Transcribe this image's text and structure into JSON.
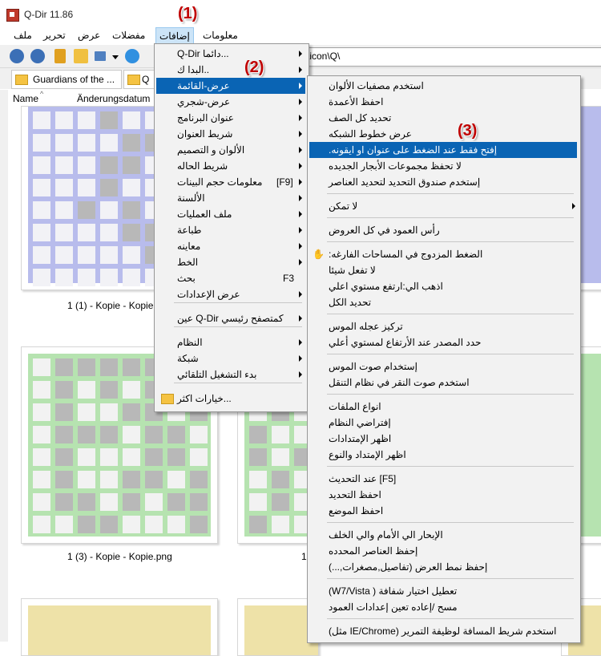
{
  "window": {
    "title": "Q-Dir 11.86"
  },
  "menubar": {
    "items": [
      "ملف",
      "تحرير",
      "عرض",
      "مفضلات",
      "إضافات",
      "معلومات"
    ]
  },
  "address": {
    "value": "\\icon\\Q\\"
  },
  "tabs": [
    {
      "label": "Guardians of the ..."
    },
    {
      "label": "Q"
    }
  ],
  "columns": {
    "name": "Name",
    "date": "Änderungsdatum"
  },
  "files": [
    {
      "caption": "1 (1) - Kopie - Kopie."
    },
    {
      "caption": "1 (3) - Kopie - Kopie.png"
    },
    {
      "caption": "1"
    }
  ],
  "callouts": [
    "(1)",
    "(2)",
    "(3)"
  ],
  "menu1": {
    "items": [
      {
        "label": "Q-Dir دائما...",
        "arrow": true
      },
      {
        "label": "البدا ك..",
        "arrow": true
      },
      {
        "label": "عرض-القائمة",
        "arrow": true,
        "highlight": true
      },
      {
        "label": "عرض-شجري",
        "arrow": true
      },
      {
        "label": "عنوان البرنامج",
        "arrow": true
      },
      {
        "label": "شريط العنوان",
        "arrow": true
      },
      {
        "label": "الألوان و التصميم",
        "arrow": true
      },
      {
        "label": "شريط الحاله",
        "arrow": true
      },
      {
        "label": "معلومات حجم البينات",
        "arrow": true,
        "shortcut": "[F9]"
      },
      {
        "label": "الألسنة",
        "arrow": true
      },
      {
        "label": "ملف العمليات",
        "arrow": true
      },
      {
        "label": "طباعة",
        "arrow": true
      },
      {
        "label": "معاينه",
        "arrow": true
      },
      {
        "label": "الخط",
        "arrow": true
      },
      {
        "label": "بحث",
        "arrow": false,
        "shortcut": "F3"
      },
      {
        "label": "عرض الإعدادات",
        "arrow": true
      },
      {
        "label": "عين Q-Dir كمتصفح رئيسي",
        "arrow": true
      },
      {
        "label": "النظام",
        "arrow": true
      },
      {
        "label": "شبكة",
        "arrow": true
      },
      {
        "label": "بدء التشغيل التلقائي",
        "arrow": true
      },
      {
        "label": "خيارات اكثر...",
        "arrow": false
      }
    ]
  },
  "menu2": {
    "items": [
      {
        "label": "استخدم مصفيات الألوان"
      },
      {
        "label": "احفظ الأعمدة"
      },
      {
        "label": "تحديد كل الصف"
      },
      {
        "label": "عرض خطوط الشبكه"
      },
      {
        "label": "إفتح فقط عند الضغط على عنوان او ايقونه.",
        "highlight": true
      },
      {
        "label": "لا تحفظ مجموعات الأبجار الجديده"
      },
      {
        "label": "إستخدم صندوق التحديد لتحديد العناصر"
      },
      {
        "label": "لا تمكن",
        "arrow": true
      },
      {
        "label": "رأس العمود في كل العروض"
      },
      {
        "label": "الضغط المزدوج في المساحات الفارغه:"
      },
      {
        "label": "لا تفعل شيئا"
      },
      {
        "label": "اذهب الي:ارتفع مستوي اعلي"
      },
      {
        "label": "تحديد الكل"
      },
      {
        "label": "تركيز عجله الموس"
      },
      {
        "label": "حدد المصدر عند الأرتفاع لمستوي أعلي"
      },
      {
        "label": "إستخدام صوت الموس"
      },
      {
        "label": "استخدم صوت النقر في نظام التنقل"
      },
      {
        "label": "انواع الملفات"
      },
      {
        "label": "إفتراضي النظام"
      },
      {
        "label": "اظهر الإمتدادات"
      },
      {
        "label": "اظهر الإمتداد والنوع"
      },
      {
        "label": "[F5] عند التحديث"
      },
      {
        "label": "احفظ التحديد"
      },
      {
        "label": "احفظ الموضع"
      },
      {
        "label": "الإبحار الي الأمام والي الخلف"
      },
      {
        "label": "إحفظ العناصر المحدده"
      },
      {
        "label": "إحفظ نمط العرض (تفاصيل,مصغرات,...)"
      },
      {
        "label": "تعطيل اختيار شفافة ( W7/Vista)"
      },
      {
        "label": "مسح /إعاده تعين إعدادات العمود"
      },
      {
        "label": "استخدم شريط المسافة لوظيفة التمرير (IE/Chrome مثل)"
      }
    ]
  },
  "colors": {
    "highlight": "#0a64b4",
    "callout": "#c00000",
    "menuHover": "#cce4f7"
  }
}
